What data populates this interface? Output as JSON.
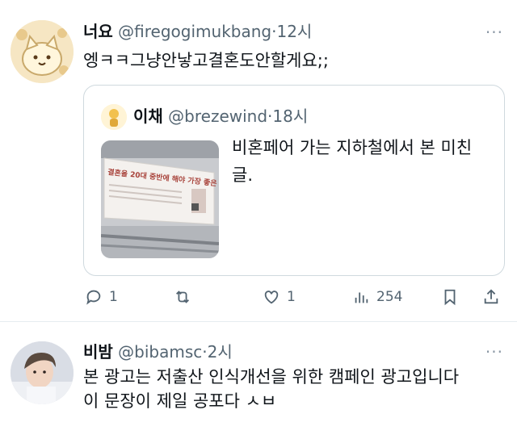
{
  "tweets": [
    {
      "display_name": "너요",
      "handle": "@firegogimukbang",
      "separator": "·",
      "time": "12시",
      "text": "엥ㅋㅋ그냥안낳고결혼도안할게요;;",
      "more": "···",
      "quote": {
        "display_name": "이채",
        "handle": "@brezewind",
        "separator": "·",
        "time": "18시",
        "text": "비혼페어 가는 지하철에서 본 미친글.",
        "image_text": "결혼을 20대 중반에 해야 가장 좋은 이유"
      },
      "actions": {
        "reply_count": "1",
        "retweet_count": "",
        "like_count": "1",
        "view_count": "254"
      }
    },
    {
      "display_name": "비밤",
      "handle": "@bibamsc",
      "separator": "·",
      "time": "2시",
      "text_lines": [
        "본 광고는 저출산 인식개선을 위한 캠페인 광고입니다",
        "이 문장이 제일 공포다 ㅅㅂ"
      ],
      "more": "···"
    }
  ],
  "icons": {
    "reply": "reply-icon",
    "retweet": "retweet-icon",
    "like": "heart-icon",
    "views": "views-icon",
    "bookmark": "bookmark-icon",
    "share": "share-icon"
  },
  "colors": {
    "text": "#0f1419",
    "secondary": "#536471",
    "border": "#cfd9de"
  }
}
